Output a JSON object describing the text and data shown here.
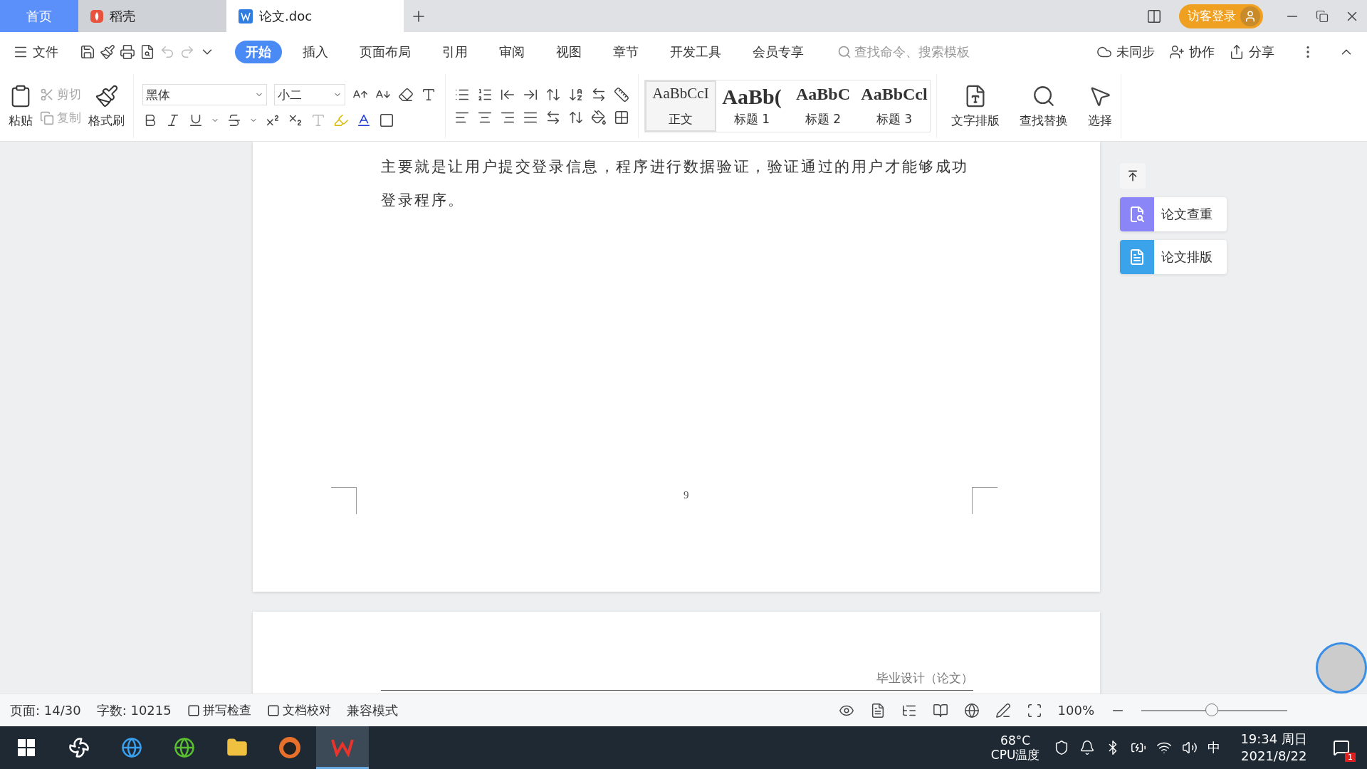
{
  "tabs": [
    {
      "label": "首页",
      "kind": "home",
      "selected": false
    },
    {
      "label": "稻壳",
      "kind": "docer",
      "selected": false
    },
    {
      "label": "论文.doc",
      "kind": "doc",
      "selected": true
    }
  ],
  "titlebar": {
    "login": "访客登录"
  },
  "menu": {
    "file": "文件",
    "tabs": [
      {
        "label": "开始",
        "selected": true
      },
      {
        "label": "插入",
        "selected": false
      },
      {
        "label": "页面布局",
        "selected": false
      },
      {
        "label": "引用",
        "selected": false
      },
      {
        "label": "审阅",
        "selected": false
      },
      {
        "label": "视图",
        "selected": false
      },
      {
        "label": "章节",
        "selected": false
      },
      {
        "label": "开发工具",
        "selected": false
      },
      {
        "label": "会员专享",
        "selected": false
      }
    ],
    "search": {
      "placeholder": "查找命令、搜索模板"
    },
    "actions": [
      {
        "label": "未同步",
        "kind": "sync"
      },
      {
        "label": "协作",
        "kind": "collab"
      },
      {
        "label": "分享",
        "kind": "share"
      }
    ]
  },
  "ribbon": {
    "paste": "粘贴",
    "cut": {
      "label": "剪切",
      "disabled": true
    },
    "copy": {
      "label": "复制",
      "disabled": true
    },
    "format_painter": "格式刷",
    "font": "黑体",
    "size": "小二",
    "styles": [
      {
        "preview": "AaBbCcI",
        "label": "正文",
        "kind": "normal",
        "selected": true
      },
      {
        "preview": "AaBb(",
        "label": "标题 1",
        "kind": "h1",
        "selected": false
      },
      {
        "preview": "AaBbC",
        "label": "标题 2",
        "kind": "h2",
        "selected": false
      },
      {
        "preview": "AaBbCcl",
        "label": "标题 3",
        "kind": "h3",
        "selected": false
      }
    ],
    "tools": [
      {
        "label": "文字排版",
        "kind": "layout"
      },
      {
        "label": "查找替换",
        "kind": "find"
      },
      {
        "label": "选择",
        "kind": "select"
      }
    ]
  },
  "document": {
    "paragraph": "主要就是让用户提交登录信息，程序进行数据验证，验证通过的用户才能够成功登录程序。",
    "page_number": "9",
    "header": "毕业设计（论文）"
  },
  "side_panel": [
    {
      "label": "论文查重",
      "color": "#8b86f7"
    },
    {
      "label": "论文排版",
      "color": "#3aa3ea"
    }
  ],
  "status_bar": {
    "page": "页面: 14/30",
    "words": "字数: 10215",
    "spell": "拼写检查",
    "proof": "文档校对",
    "mode": "兼容模式",
    "zoom": "100%",
    "zoom_slider": {
      "level": 0.49
    }
  },
  "taskbar": {
    "temp": "68°C",
    "temp_label": "CPU温度",
    "ime": "中",
    "time": "19:34 周日",
    "date": "2021/8/22",
    "badge": "1"
  }
}
